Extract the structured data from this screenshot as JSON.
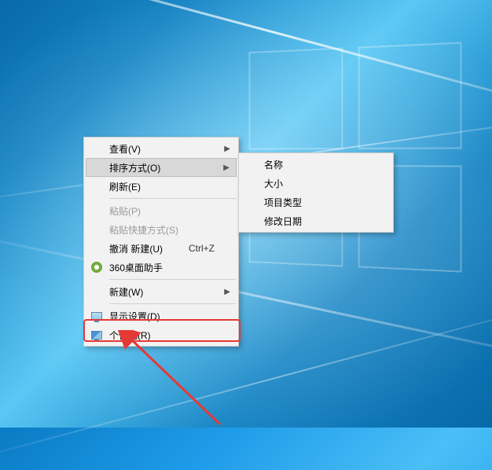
{
  "menu": {
    "view": {
      "label": "查看(V)"
    },
    "sort": {
      "label": "排序方式(O)"
    },
    "refresh": {
      "label": "刷新(E)"
    },
    "paste": {
      "label": "粘贴(P)"
    },
    "paste_shortcut": {
      "label": "粘贴快捷方式(S)"
    },
    "undo_new": {
      "label": "撤消 新建(U)",
      "shortcut": "Ctrl+Z"
    },
    "desktop_helper": {
      "label": "360桌面助手"
    },
    "new": {
      "label": "新建(W)"
    },
    "display_settings": {
      "label": "显示设置(D)"
    },
    "personalize": {
      "label": "个性化(R)"
    }
  },
  "submenu": {
    "name": {
      "label": "名称"
    },
    "size": {
      "label": "大小"
    },
    "item_type": {
      "label": "项目类型"
    },
    "date_modified": {
      "label": "修改日期"
    }
  }
}
